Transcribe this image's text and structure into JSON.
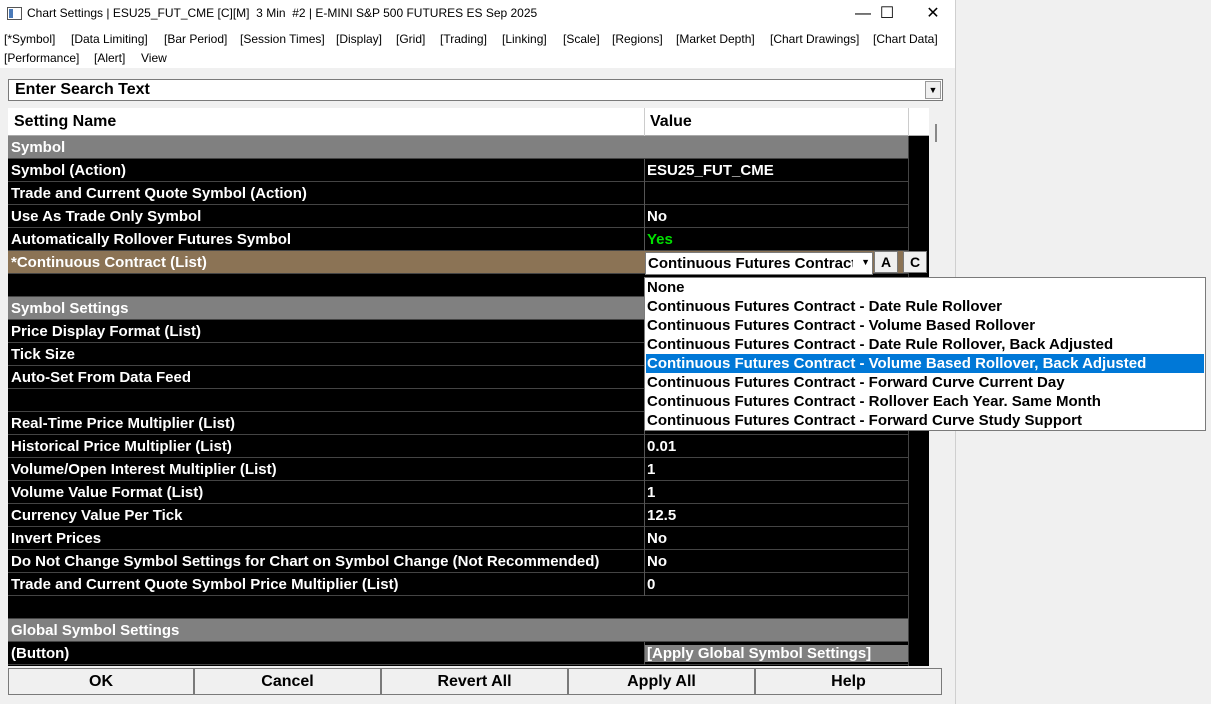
{
  "window": {
    "title": "Chart Settings | ESU25_FUT_CME [C][M]  3 Min  #2 | E-MINI S&P 500 FUTURES ES Sep 2025",
    "minimize": "—",
    "maximize": "☐",
    "close": "✕"
  },
  "menu": {
    "items": [
      "[*Symbol]",
      "[Data Limiting]",
      "[Bar Period]",
      "[Session Times]",
      "[Display]",
      "[Grid]",
      "[Trading]",
      "[Linking]",
      "[Scale]",
      "[Regions]",
      "[Market Depth]",
      "[Chart Drawings]",
      "[Chart Data]",
      "[Performance]",
      "[Alert]",
      "View"
    ]
  },
  "search": {
    "placeholder": "Enter Search Text"
  },
  "grid": {
    "col_name": "Setting Name",
    "col_value": "Value",
    "rows": [
      {
        "name": "Symbol",
        "value": ""
      },
      {
        "name": "Symbol (Action)",
        "value": "ESU25_FUT_CME"
      },
      {
        "name": "Trade and Current Quote Symbol (Action)",
        "value": ""
      },
      {
        "name": "Use As Trade Only Symbol",
        "value": "No"
      },
      {
        "name": "Automatically Rollover Futures Symbol",
        "value": "Yes"
      },
      {
        "name": "*Continuous Contract (List)",
        "value": ""
      },
      {
        "name": "",
        "value": ""
      },
      {
        "name": "Symbol Settings",
        "value": ""
      },
      {
        "name": "Price Display Format (List)",
        "value": ""
      },
      {
        "name": "Tick Size",
        "value": ""
      },
      {
        "name": "Auto-Set From Data Feed",
        "value": ""
      },
      {
        "name": "",
        "value": ""
      },
      {
        "name": "Real-Time Price Multiplier (List)",
        "value": ""
      },
      {
        "name": "Historical Price Multiplier (List)",
        "value": "0.01"
      },
      {
        "name": "Volume/Open Interest Multiplier (List)",
        "value": "1"
      },
      {
        "name": "Volume Value Format (List)",
        "value": "1"
      },
      {
        "name": "Currency Value Per Tick",
        "value": "12.5"
      },
      {
        "name": "Invert Prices",
        "value": "No"
      },
      {
        "name": "Do Not Change Symbol Settings for Chart on Symbol Change (Not Recommended)",
        "value": "No"
      },
      {
        "name": "Trade and Current Quote Symbol Price Multiplier (List)",
        "value": "0"
      },
      {
        "name": "",
        "value": ""
      },
      {
        "name": "Global Symbol Settings",
        "value": ""
      },
      {
        "name": " (Button)",
        "value": "[Apply Global Symbol Settings]"
      }
    ]
  },
  "combo": {
    "value": "Continuous Futures Contract - Volume Based Rollover, Back Adjusted",
    "btn_a": "A",
    "btn_c": "C"
  },
  "dropdown": {
    "options": [
      "None",
      "Continuous Futures Contract - Date Rule Rollover",
      "Continuous Futures Contract - Volume Based Rollover",
      "Continuous Futures Contract - Date Rule Rollover, Back Adjusted",
      "Continuous Futures Contract - Volume Based Rollover, Back Adjusted",
      "Continuous Futures Contract - Forward Curve Current Day",
      "Continuous Futures Contract - Rollover Each Year. Same Month",
      "Continuous Futures Contract - Forward Curve Study Support"
    ],
    "selected_index": 4
  },
  "buttons": {
    "ok": "OK",
    "cancel": "Cancel",
    "revert": "Revert All",
    "apply": "Apply All",
    "help": "Help"
  },
  "colors": {
    "yes_green": "#00e000",
    "selection_blue": "#0078d7",
    "section_gray": "#808080",
    "highlight_brown": "#8b7355"
  }
}
